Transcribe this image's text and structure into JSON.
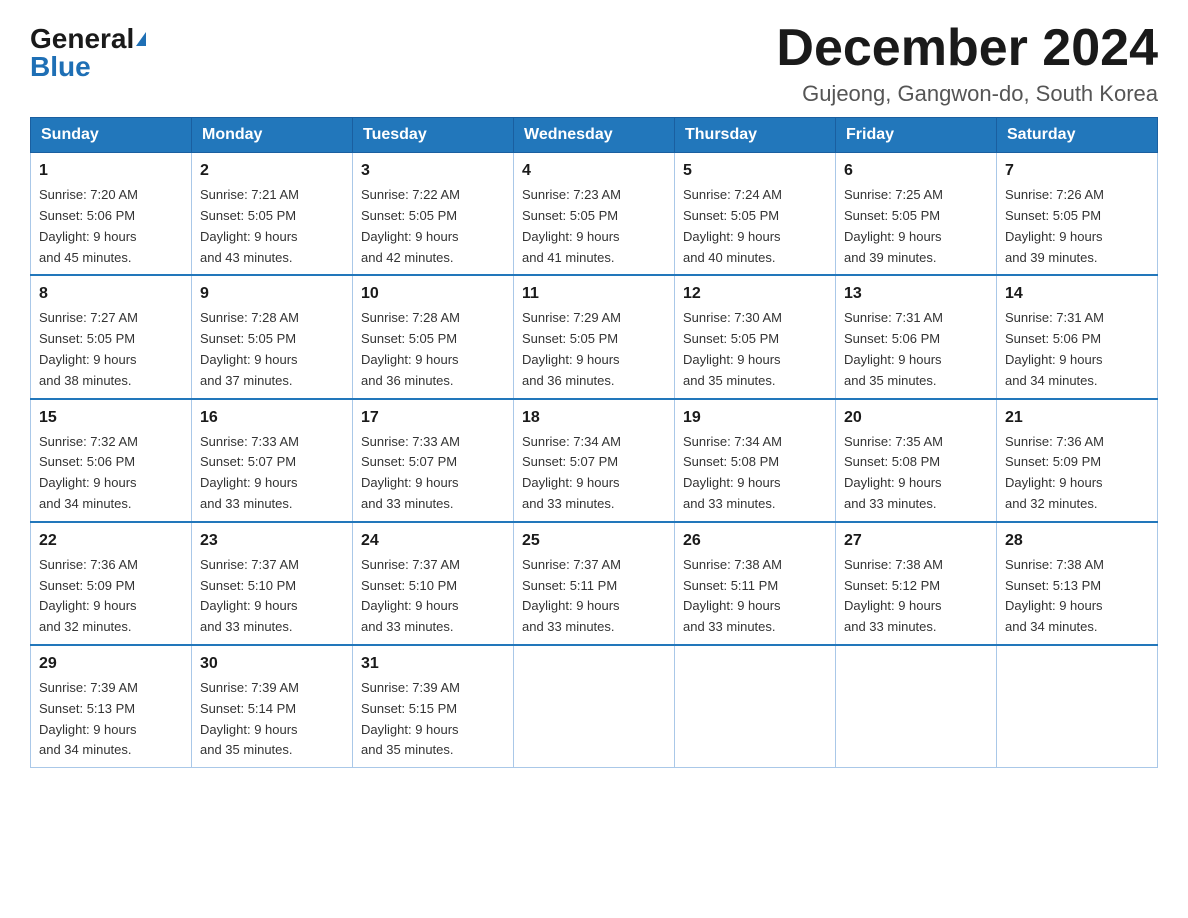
{
  "logo": {
    "general": "General",
    "blue": "Blue"
  },
  "title": "December 2024",
  "location": "Gujeong, Gangwon-do, South Korea",
  "days_of_week": [
    "Sunday",
    "Monday",
    "Tuesday",
    "Wednesday",
    "Thursday",
    "Friday",
    "Saturday"
  ],
  "weeks": [
    [
      {
        "day": "1",
        "sunrise": "7:20 AM",
        "sunset": "5:06 PM",
        "daylight": "9 hours and 45 minutes."
      },
      {
        "day": "2",
        "sunrise": "7:21 AM",
        "sunset": "5:05 PM",
        "daylight": "9 hours and 43 minutes."
      },
      {
        "day": "3",
        "sunrise": "7:22 AM",
        "sunset": "5:05 PM",
        "daylight": "9 hours and 42 minutes."
      },
      {
        "day": "4",
        "sunrise": "7:23 AM",
        "sunset": "5:05 PM",
        "daylight": "9 hours and 41 minutes."
      },
      {
        "day": "5",
        "sunrise": "7:24 AM",
        "sunset": "5:05 PM",
        "daylight": "9 hours and 40 minutes."
      },
      {
        "day": "6",
        "sunrise": "7:25 AM",
        "sunset": "5:05 PM",
        "daylight": "9 hours and 39 minutes."
      },
      {
        "day": "7",
        "sunrise": "7:26 AM",
        "sunset": "5:05 PM",
        "daylight": "9 hours and 39 minutes."
      }
    ],
    [
      {
        "day": "8",
        "sunrise": "7:27 AM",
        "sunset": "5:05 PM",
        "daylight": "9 hours and 38 minutes."
      },
      {
        "day": "9",
        "sunrise": "7:28 AM",
        "sunset": "5:05 PM",
        "daylight": "9 hours and 37 minutes."
      },
      {
        "day": "10",
        "sunrise": "7:28 AM",
        "sunset": "5:05 PM",
        "daylight": "9 hours and 36 minutes."
      },
      {
        "day": "11",
        "sunrise": "7:29 AM",
        "sunset": "5:05 PM",
        "daylight": "9 hours and 36 minutes."
      },
      {
        "day": "12",
        "sunrise": "7:30 AM",
        "sunset": "5:05 PM",
        "daylight": "9 hours and 35 minutes."
      },
      {
        "day": "13",
        "sunrise": "7:31 AM",
        "sunset": "5:06 PM",
        "daylight": "9 hours and 35 minutes."
      },
      {
        "day": "14",
        "sunrise": "7:31 AM",
        "sunset": "5:06 PM",
        "daylight": "9 hours and 34 minutes."
      }
    ],
    [
      {
        "day": "15",
        "sunrise": "7:32 AM",
        "sunset": "5:06 PM",
        "daylight": "9 hours and 34 minutes."
      },
      {
        "day": "16",
        "sunrise": "7:33 AM",
        "sunset": "5:07 PM",
        "daylight": "9 hours and 33 minutes."
      },
      {
        "day": "17",
        "sunrise": "7:33 AM",
        "sunset": "5:07 PM",
        "daylight": "9 hours and 33 minutes."
      },
      {
        "day": "18",
        "sunrise": "7:34 AM",
        "sunset": "5:07 PM",
        "daylight": "9 hours and 33 minutes."
      },
      {
        "day": "19",
        "sunrise": "7:34 AM",
        "sunset": "5:08 PM",
        "daylight": "9 hours and 33 minutes."
      },
      {
        "day": "20",
        "sunrise": "7:35 AM",
        "sunset": "5:08 PM",
        "daylight": "9 hours and 33 minutes."
      },
      {
        "day": "21",
        "sunrise": "7:36 AM",
        "sunset": "5:09 PM",
        "daylight": "9 hours and 32 minutes."
      }
    ],
    [
      {
        "day": "22",
        "sunrise": "7:36 AM",
        "sunset": "5:09 PM",
        "daylight": "9 hours and 32 minutes."
      },
      {
        "day": "23",
        "sunrise": "7:37 AM",
        "sunset": "5:10 PM",
        "daylight": "9 hours and 33 minutes."
      },
      {
        "day": "24",
        "sunrise": "7:37 AM",
        "sunset": "5:10 PM",
        "daylight": "9 hours and 33 minutes."
      },
      {
        "day": "25",
        "sunrise": "7:37 AM",
        "sunset": "5:11 PM",
        "daylight": "9 hours and 33 minutes."
      },
      {
        "day": "26",
        "sunrise": "7:38 AM",
        "sunset": "5:11 PM",
        "daylight": "9 hours and 33 minutes."
      },
      {
        "day": "27",
        "sunrise": "7:38 AM",
        "sunset": "5:12 PM",
        "daylight": "9 hours and 33 minutes."
      },
      {
        "day": "28",
        "sunrise": "7:38 AM",
        "sunset": "5:13 PM",
        "daylight": "9 hours and 34 minutes."
      }
    ],
    [
      {
        "day": "29",
        "sunrise": "7:39 AM",
        "sunset": "5:13 PM",
        "daylight": "9 hours and 34 minutes."
      },
      {
        "day": "30",
        "sunrise": "7:39 AM",
        "sunset": "5:14 PM",
        "daylight": "9 hours and 35 minutes."
      },
      {
        "day": "31",
        "sunrise": "7:39 AM",
        "sunset": "5:15 PM",
        "daylight": "9 hours and 35 minutes."
      },
      null,
      null,
      null,
      null
    ]
  ],
  "labels": {
    "sunrise": "Sunrise:",
    "sunset": "Sunset:",
    "daylight": "Daylight:"
  }
}
